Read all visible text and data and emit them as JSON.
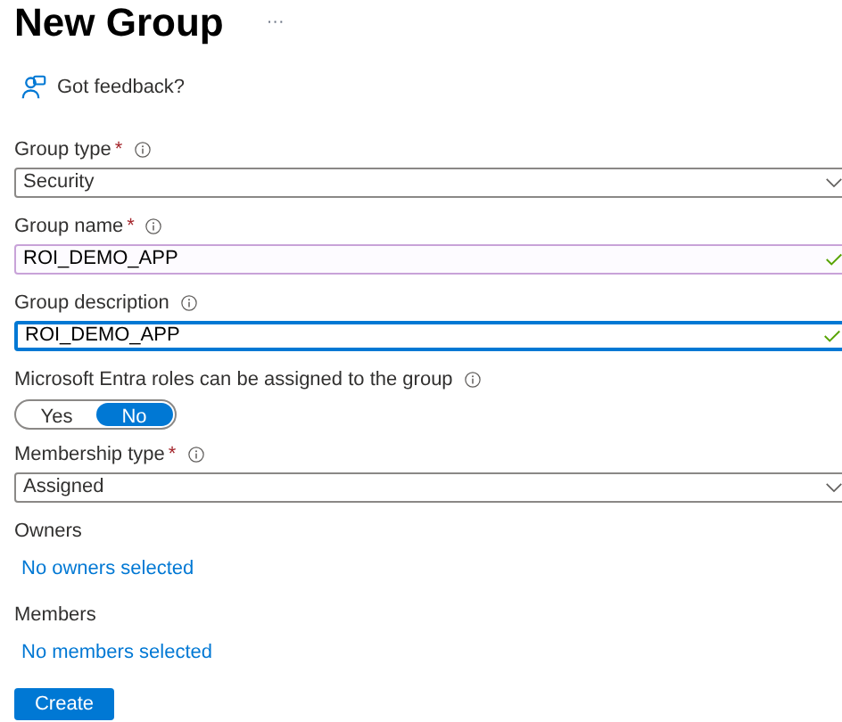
{
  "title": "New Group",
  "more": "···",
  "feedback": "Got feedback?",
  "fields": [
    {
      "kind": "select",
      "label": "Group type",
      "required_mark": "*",
      "info": true,
      "value": "Security"
    },
    {
      "kind": "text",
      "label": "Group name",
      "required_mark": "*",
      "info": true,
      "value": "ROI_DEMO_APP",
      "valid": true,
      "focused": false,
      "hovered": true
    },
    {
      "kind": "text",
      "label": "Group description",
      "info": true,
      "value": "ROI_DEMO_APP",
      "valid": true,
      "focused": true,
      "hovered": false
    },
    {
      "kind": "toggle",
      "label": "Microsoft Entra roles can be assigned to the group",
      "info": true,
      "options": [
        {
          "label": "Yes",
          "selected": false
        },
        {
          "label": "No",
          "selected": true
        }
      ]
    },
    {
      "kind": "select",
      "label": "Membership type",
      "required_mark": "*",
      "info": true,
      "value": "Assigned"
    },
    {
      "kind": "link",
      "label": "Owners",
      "value": "No owners selected"
    },
    {
      "kind": "link",
      "label": "Members",
      "value": "No members selected"
    }
  ],
  "create_button": "Create"
}
